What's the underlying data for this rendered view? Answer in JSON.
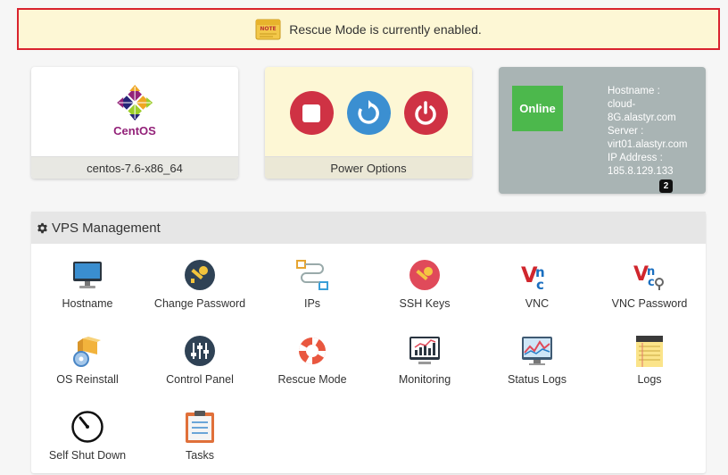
{
  "alert": {
    "message": "Rescue Mode is currently enabled.",
    "icon": "note-icon"
  },
  "os_card": {
    "logo_text": "CentOS",
    "label": "centos-7.6-x86_64"
  },
  "power_card": {
    "label": "Power Options",
    "buttons": [
      {
        "name": "stop",
        "icon": "stop-icon"
      },
      {
        "name": "restart",
        "icon": "restart-icon"
      },
      {
        "name": "power",
        "icon": "power-icon"
      }
    ]
  },
  "status_card": {
    "status": "Online",
    "hostname_label": "Hostname :",
    "hostname_value": "cloud-8G.alastyr.com",
    "server_label": "Server :",
    "server_value": "virt01.alastyr.com",
    "ip_label": "IP Address :",
    "ip_value": "185.8.129.133",
    "count": "2"
  },
  "management": {
    "title": "VPS Management",
    "tiles": [
      {
        "label": "Hostname",
        "icon": "monitor-icon"
      },
      {
        "label": "Change Password",
        "icon": "key-icon"
      },
      {
        "label": "IPs",
        "icon": "network-icon"
      },
      {
        "label": "SSH Keys",
        "icon": "ssh-key-icon"
      },
      {
        "label": "VNC",
        "icon": "vnc-icon"
      },
      {
        "label": "VNC Password",
        "icon": "vnc-password-icon"
      },
      {
        "label": "OS Reinstall",
        "icon": "os-reinstall-icon"
      },
      {
        "label": "Control Panel",
        "icon": "control-panel-icon"
      },
      {
        "label": "Rescue Mode",
        "icon": "lifebuoy-icon"
      },
      {
        "label": "Monitoring",
        "icon": "monitoring-icon"
      },
      {
        "label": "Status Logs",
        "icon": "status-logs-icon"
      },
      {
        "label": "Logs",
        "icon": "notepad-icon"
      },
      {
        "label": "Self Shut Down",
        "icon": "timer-icon"
      },
      {
        "label": "Tasks",
        "icon": "tasks-icon"
      }
    ]
  },
  "colors": {
    "alert_border": "#d9232e",
    "alert_bg": "#fdf7d5",
    "online": "#4cb84c",
    "status_bg": "#a9b4b4",
    "danger": "#cf3244",
    "primary": "#3b8fd1"
  }
}
